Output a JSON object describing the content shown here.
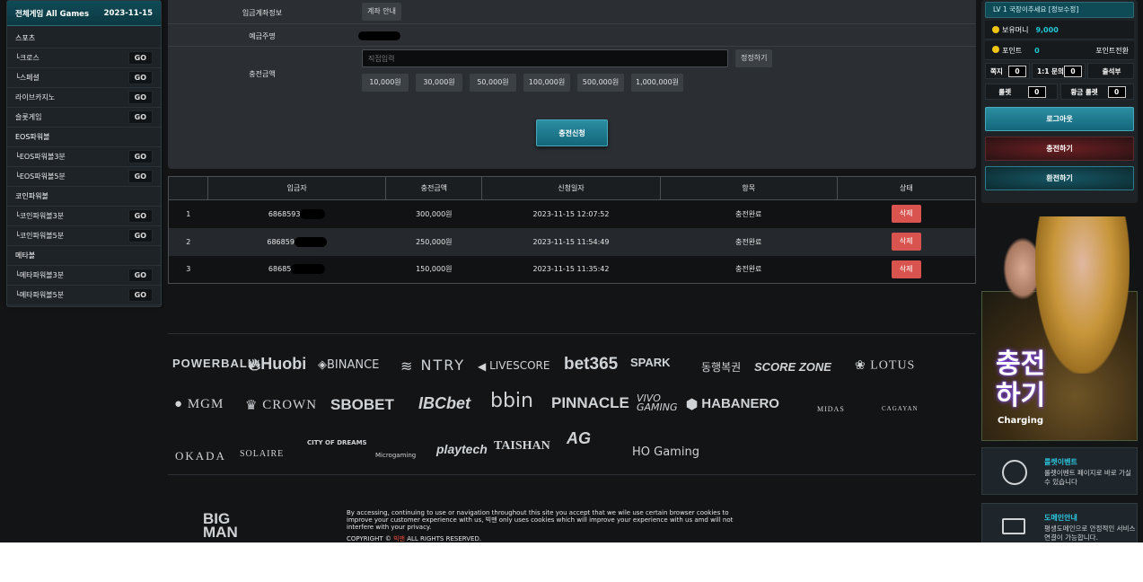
{
  "left_panel": {
    "title": "전체게임 All Games",
    "date": "2023-11-15",
    "go_label": "GO",
    "items": [
      {
        "label": "스포츠",
        "go": false
      },
      {
        "label": "└크로스",
        "go": true
      },
      {
        "label": "└스페셜",
        "go": true
      },
      {
        "label": "라이브카지노",
        "go": true
      },
      {
        "label": "슬롯게임",
        "go": true
      },
      {
        "label": "EOS파워볼",
        "go": false
      },
      {
        "label": "└EOS파워볼3분",
        "go": true
      },
      {
        "label": "└EOS파워볼5분",
        "go": true
      },
      {
        "label": "코인파워볼",
        "go": false
      },
      {
        "label": "└코인파워볼3분",
        "go": true
      },
      {
        "label": "└코인파워볼5분",
        "go": true
      },
      {
        "label": "메타볼",
        "go": false
      },
      {
        "label": "└메타파워볼3분",
        "go": true
      },
      {
        "label": "└메타파워볼5분",
        "go": true
      }
    ]
  },
  "deposit_form": {
    "account_info_label": "입금계좌정보",
    "account_button": "계좌 안내",
    "depositor_label": "예금주명",
    "amount_label": "충전금액",
    "amount_placeholder": "직접입력",
    "reset_button": "정정하기",
    "presets": [
      "10,000원",
      "30,000원",
      "50,000원",
      "100,000원",
      "500,000원",
      "1,000,000원"
    ],
    "submit_button": "충전신청"
  },
  "history_table": {
    "headers": [
      "",
      "입금자",
      "충전금액",
      "신청일자",
      "항목",
      "상태"
    ],
    "delete_label": "삭제",
    "rows": [
      {
        "no": "1",
        "depositor": "6868593",
        "amount": "300,000원",
        "date": "2023-11-15 12:07:52",
        "item": "충전완료"
      },
      {
        "no": "2",
        "depositor": "686859",
        "amount": "250,000원",
        "date": "2023-11-15 11:54:49",
        "item": "충전완료"
      },
      {
        "no": "3",
        "depositor": "68685",
        "amount": "150,000원",
        "date": "2023-11-15 11:35:42",
        "item": "충전완료"
      }
    ]
  },
  "partners": {
    "row1": [
      "POWERBALL",
      "Huobi",
      "BINANCE",
      "NTRY",
      "LIVESCORE",
      "bet365",
      "SPARK",
      "동행복권",
      "SCORE ZONE",
      "LOTUS"
    ],
    "row2": [
      "MGM",
      "CROWN",
      "SBOBET",
      "IBCbet",
      "bbin",
      "PINNACLE",
      "VIVO GAMING",
      "HABANERO",
      "MIDAS",
      "CAGAYAN"
    ],
    "row3": [
      "OKADA",
      "SOLAIRE",
      "CITY OF DREAMS",
      "Microgaming",
      "playtech",
      "TAISHAN",
      "AG",
      "HO Gaming"
    ]
  },
  "footer": {
    "logo": "BIG MAN",
    "notice": "By accessing, continuing to use or navigation throughout this site you accept that we wile use certain browser cookies to improve your customer experience with us, 빅맨 only uses cookies which will improve your experience with us amd will not interfere with your privacy.",
    "copyright_prefix": "COPYRIGHT ©",
    "copyright_brand": "빅맨",
    "copyright_suffix": "ALL RIGHTS RESERVED."
  },
  "user_panel": {
    "level": "LV 1  국장이추세요 [정보수정]",
    "money_label": "보유머니",
    "money_value": "9,000",
    "point_label": "포인트",
    "point_value": "0",
    "point_exchange": "포인트전환",
    "note_label": "쪽지",
    "note_count": "0",
    "inquiry_label": "1:1 문의",
    "inquiry_count": "0",
    "attendance_label": "출석부",
    "roulette_label": "룰렛",
    "roulette_count": "0",
    "gold_roulette_label": "황금 룰렛",
    "gold_roulette_count": "0",
    "logout": "로그아웃",
    "charge": "충전하기",
    "exchange": "환전하기"
  },
  "banner": {
    "title_line1": "충전",
    "title_line2": "하기",
    "subtitle": "Charging"
  },
  "info_cards": [
    {
      "title": "룰렛이벤트",
      "desc": "룰렛이벤트 페이지로 바로 가실 수 있습니다",
      "icon": "roulette-icon"
    },
    {
      "title": "도메인안내",
      "desc": "평생도메인으로 안정적인 서비스연결이 가능합니다.",
      "icon": "monitor-icon"
    }
  ]
}
